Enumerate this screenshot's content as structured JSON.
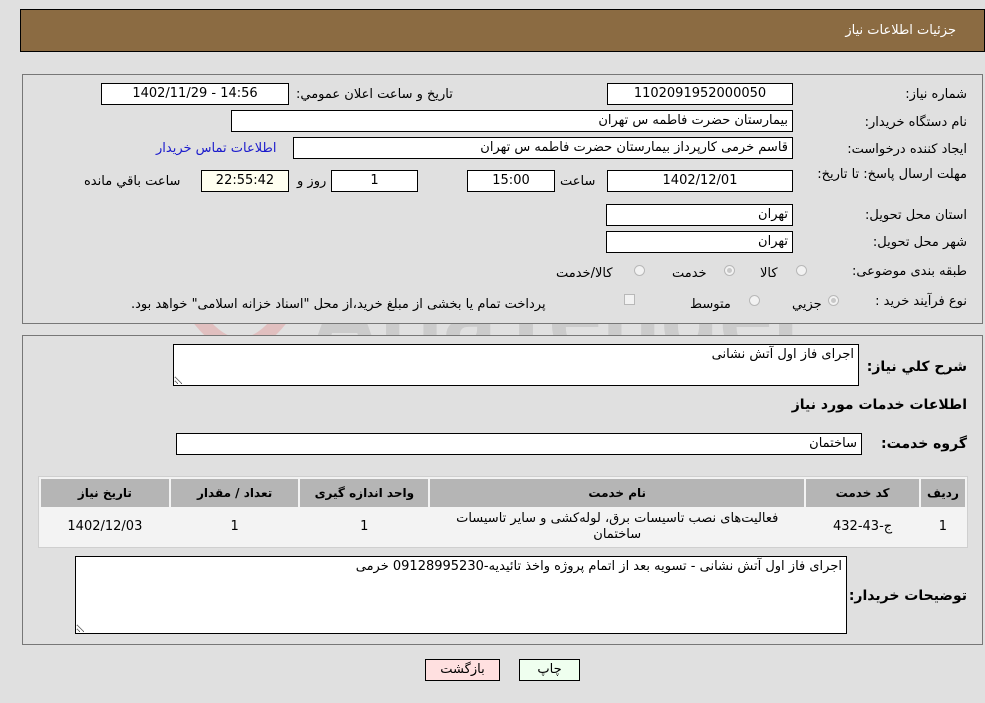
{
  "header": {
    "title": "جزئیات اطلاعات نیاز"
  },
  "details": {
    "need_number_label": "شماره نیاز:",
    "need_number": "1102091952000050",
    "announce_label": "تاریخ و ساعت اعلان عمومي:",
    "announce_value": "1402/11/29 - 14:56",
    "buyer_org_label": "نام دستگاه خریدار:",
    "buyer_org": "بیمارستان حضرت فاطمه س  تهران",
    "requester_label": "ایجاد کننده درخواست:",
    "requester": "قاسم خرمی کارپرداز بیمارستان حضرت فاطمه س  تهران",
    "contact_link": "اطلاعات تماس خریدار",
    "deadline_label": "مهلت ارسال پاسخ: تا تاریخ:",
    "deadline_date": "1402/12/01",
    "time_label": "ساعت",
    "deadline_time": "15:00",
    "days_value": "1",
    "days_label": "روز و",
    "remaining_time": "22:55:42",
    "remaining_label": "ساعت باقي مانده",
    "province_label": "استان محل تحویل:",
    "province": "تهران",
    "city_label": "شهر محل تحویل:",
    "city": "تهران",
    "category_label": "طبقه بندی موضوعی:",
    "category_options": [
      "کالا",
      "خدمت",
      "کالا/خدمت"
    ],
    "category_selected": "خدمت",
    "process_label": "نوع فرآیند خرید :",
    "process_options": [
      "جزيي",
      "متوسط"
    ],
    "process_selected": "جزيي",
    "treasury_note": "پرداخت تمام یا بخشی از مبلغ خرید،از محل \"اسناد خزانه اسلامی\" خواهد بود."
  },
  "summary": {
    "description_label": "شرح کلي نیاز:",
    "description": "اجرای فاز اول آتش نشانی",
    "services_heading": "اطلاعات خدمات مورد نیاز",
    "service_group_label": "گروه خدمت:",
    "service_group": "ساختمان"
  },
  "table": {
    "headers": [
      "ردیف",
      "کد خدمت",
      "نام خدمت",
      "واحد اندازه گیری",
      "تعداد / مقدار",
      "تاریخ نیاز"
    ],
    "rows": [
      [
        "1",
        "ج-43-432",
        "فعالیت‌های نصب تاسیسات برق، لوله‌کشی و سایر تاسیسات ساختمان",
        "1",
        "1",
        "1402/12/03"
      ]
    ]
  },
  "buyer_notes": {
    "label": "توضیحات خریدار:",
    "text": "اجرای فاز اول آتش نشانی - تسویه بعد از اتمام پروژه واخذ تائیدیه-09128995230 خرمی"
  },
  "buttons": {
    "print": "چاپ",
    "back": "بازگشت"
  },
  "watermark": {
    "text": "AriaTender.neT"
  },
  "colors": {
    "header_bg": "#8b6b42",
    "print_bg": "#efffef",
    "back_bg": "#ffe0e0",
    "link": "#1a1acc"
  }
}
